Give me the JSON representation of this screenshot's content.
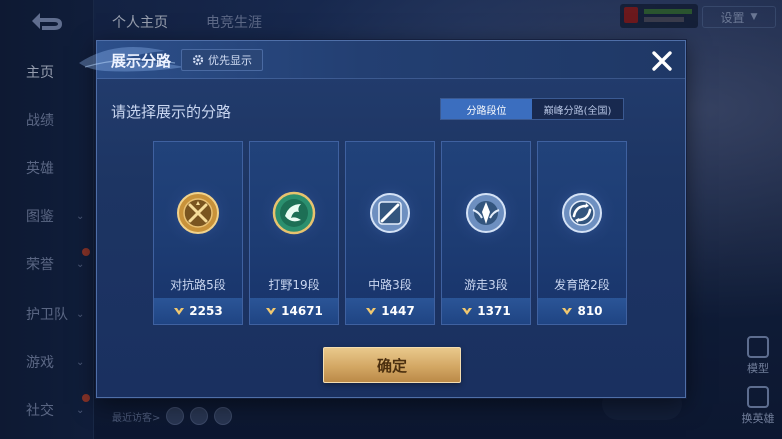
{
  "background": {
    "top_tabs": [
      "个人主页",
      "电竞生涯"
    ],
    "settings_label": "设置",
    "nav_items": [
      {
        "label": "主页",
        "active": true,
        "chevron": false,
        "dot": false
      },
      {
        "label": "战绩",
        "active": false,
        "chevron": false,
        "dot": false
      },
      {
        "label": "英雄",
        "active": false,
        "chevron": false,
        "dot": false
      },
      {
        "label": "图鉴",
        "active": false,
        "chevron": true,
        "dot": false
      },
      {
        "label": "荣誉",
        "active": false,
        "chevron": true,
        "dot": true
      },
      {
        "label": "护卫队",
        "active": false,
        "chevron": true,
        "dot": false
      },
      {
        "label": "游戏",
        "active": false,
        "chevron": true,
        "dot": false
      },
      {
        "label": "社交",
        "active": false,
        "chevron": true,
        "dot": true
      }
    ],
    "recent_visitors_label": "最近访客>",
    "right_tools": [
      "模型",
      "换英雄"
    ]
  },
  "modal": {
    "title": "展示分路",
    "priority_label": "优先显示",
    "subtitle": "请选择展示的分路",
    "toggle": {
      "options": [
        "分路段位",
        "巅峰分路(全国)"
      ],
      "selected": 0
    },
    "cards": [
      {
        "rank": "对抗路5段",
        "score": "2253",
        "emblem": "clash-lane-emblem",
        "color": "#d8a64a"
      },
      {
        "rank": "打野19段",
        "score": "14671",
        "emblem": "jungle-emblem",
        "color": "#3fae8c"
      },
      {
        "rank": "中路3段",
        "score": "1447",
        "emblem": "mid-lane-emblem",
        "color": "#8fb0dc"
      },
      {
        "rank": "游走3段",
        "score": "1371",
        "emblem": "roam-emblem",
        "color": "#8fb0dc"
      },
      {
        "rank": "发育路2段",
        "score": "810",
        "emblem": "farm-lane-emblem",
        "color": "#8fb0dc"
      }
    ],
    "confirm_label": "确定"
  }
}
